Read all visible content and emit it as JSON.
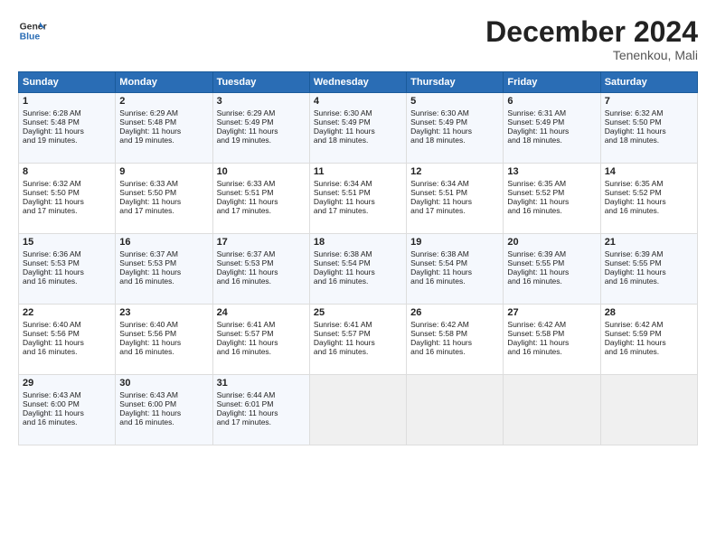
{
  "header": {
    "logo_line1": "General",
    "logo_line2": "Blue",
    "month": "December 2024",
    "location": "Tenenkou, Mali"
  },
  "days_of_week": [
    "Sunday",
    "Monday",
    "Tuesday",
    "Wednesday",
    "Thursday",
    "Friday",
    "Saturday"
  ],
  "weeks": [
    [
      {
        "day": "1",
        "lines": [
          "Sunrise: 6:28 AM",
          "Sunset: 5:48 PM",
          "Daylight: 11 hours",
          "and 19 minutes."
        ]
      },
      {
        "day": "2",
        "lines": [
          "Sunrise: 6:29 AM",
          "Sunset: 5:48 PM",
          "Daylight: 11 hours",
          "and 19 minutes."
        ]
      },
      {
        "day": "3",
        "lines": [
          "Sunrise: 6:29 AM",
          "Sunset: 5:49 PM",
          "Daylight: 11 hours",
          "and 19 minutes."
        ]
      },
      {
        "day": "4",
        "lines": [
          "Sunrise: 6:30 AM",
          "Sunset: 5:49 PM",
          "Daylight: 11 hours",
          "and 18 minutes."
        ]
      },
      {
        "day": "5",
        "lines": [
          "Sunrise: 6:30 AM",
          "Sunset: 5:49 PM",
          "Daylight: 11 hours",
          "and 18 minutes."
        ]
      },
      {
        "day": "6",
        "lines": [
          "Sunrise: 6:31 AM",
          "Sunset: 5:49 PM",
          "Daylight: 11 hours",
          "and 18 minutes."
        ]
      },
      {
        "day": "7",
        "lines": [
          "Sunrise: 6:32 AM",
          "Sunset: 5:50 PM",
          "Daylight: 11 hours",
          "and 18 minutes."
        ]
      }
    ],
    [
      {
        "day": "8",
        "lines": [
          "Sunrise: 6:32 AM",
          "Sunset: 5:50 PM",
          "Daylight: 11 hours",
          "and 17 minutes."
        ]
      },
      {
        "day": "9",
        "lines": [
          "Sunrise: 6:33 AM",
          "Sunset: 5:50 PM",
          "Daylight: 11 hours",
          "and 17 minutes."
        ]
      },
      {
        "day": "10",
        "lines": [
          "Sunrise: 6:33 AM",
          "Sunset: 5:51 PM",
          "Daylight: 11 hours",
          "and 17 minutes."
        ]
      },
      {
        "day": "11",
        "lines": [
          "Sunrise: 6:34 AM",
          "Sunset: 5:51 PM",
          "Daylight: 11 hours",
          "and 17 minutes."
        ]
      },
      {
        "day": "12",
        "lines": [
          "Sunrise: 6:34 AM",
          "Sunset: 5:51 PM",
          "Daylight: 11 hours",
          "and 17 minutes."
        ]
      },
      {
        "day": "13",
        "lines": [
          "Sunrise: 6:35 AM",
          "Sunset: 5:52 PM",
          "Daylight: 11 hours",
          "and 16 minutes."
        ]
      },
      {
        "day": "14",
        "lines": [
          "Sunrise: 6:35 AM",
          "Sunset: 5:52 PM",
          "Daylight: 11 hours",
          "and 16 minutes."
        ]
      }
    ],
    [
      {
        "day": "15",
        "lines": [
          "Sunrise: 6:36 AM",
          "Sunset: 5:53 PM",
          "Daylight: 11 hours",
          "and 16 minutes."
        ]
      },
      {
        "day": "16",
        "lines": [
          "Sunrise: 6:37 AM",
          "Sunset: 5:53 PM",
          "Daylight: 11 hours",
          "and 16 minutes."
        ]
      },
      {
        "day": "17",
        "lines": [
          "Sunrise: 6:37 AM",
          "Sunset: 5:53 PM",
          "Daylight: 11 hours",
          "and 16 minutes."
        ]
      },
      {
        "day": "18",
        "lines": [
          "Sunrise: 6:38 AM",
          "Sunset: 5:54 PM",
          "Daylight: 11 hours",
          "and 16 minutes."
        ]
      },
      {
        "day": "19",
        "lines": [
          "Sunrise: 6:38 AM",
          "Sunset: 5:54 PM",
          "Daylight: 11 hours",
          "and 16 minutes."
        ]
      },
      {
        "day": "20",
        "lines": [
          "Sunrise: 6:39 AM",
          "Sunset: 5:55 PM",
          "Daylight: 11 hours",
          "and 16 minutes."
        ]
      },
      {
        "day": "21",
        "lines": [
          "Sunrise: 6:39 AM",
          "Sunset: 5:55 PM",
          "Daylight: 11 hours",
          "and 16 minutes."
        ]
      }
    ],
    [
      {
        "day": "22",
        "lines": [
          "Sunrise: 6:40 AM",
          "Sunset: 5:56 PM",
          "Daylight: 11 hours",
          "and 16 minutes."
        ]
      },
      {
        "day": "23",
        "lines": [
          "Sunrise: 6:40 AM",
          "Sunset: 5:56 PM",
          "Daylight: 11 hours",
          "and 16 minutes."
        ]
      },
      {
        "day": "24",
        "lines": [
          "Sunrise: 6:41 AM",
          "Sunset: 5:57 PM",
          "Daylight: 11 hours",
          "and 16 minutes."
        ]
      },
      {
        "day": "25",
        "lines": [
          "Sunrise: 6:41 AM",
          "Sunset: 5:57 PM",
          "Daylight: 11 hours",
          "and 16 minutes."
        ]
      },
      {
        "day": "26",
        "lines": [
          "Sunrise: 6:42 AM",
          "Sunset: 5:58 PM",
          "Daylight: 11 hours",
          "and 16 minutes."
        ]
      },
      {
        "day": "27",
        "lines": [
          "Sunrise: 6:42 AM",
          "Sunset: 5:58 PM",
          "Daylight: 11 hours",
          "and 16 minutes."
        ]
      },
      {
        "day": "28",
        "lines": [
          "Sunrise: 6:42 AM",
          "Sunset: 5:59 PM",
          "Daylight: 11 hours",
          "and 16 minutes."
        ]
      }
    ],
    [
      {
        "day": "29",
        "lines": [
          "Sunrise: 6:43 AM",
          "Sunset: 6:00 PM",
          "Daylight: 11 hours",
          "and 16 minutes."
        ]
      },
      {
        "day": "30",
        "lines": [
          "Sunrise: 6:43 AM",
          "Sunset: 6:00 PM",
          "Daylight: 11 hours",
          "and 16 minutes."
        ]
      },
      {
        "day": "31",
        "lines": [
          "Sunrise: 6:44 AM",
          "Sunset: 6:01 PM",
          "Daylight: 11 hours",
          "and 17 minutes."
        ]
      },
      {
        "day": "",
        "lines": []
      },
      {
        "day": "",
        "lines": []
      },
      {
        "day": "",
        "lines": []
      },
      {
        "day": "",
        "lines": []
      }
    ]
  ]
}
